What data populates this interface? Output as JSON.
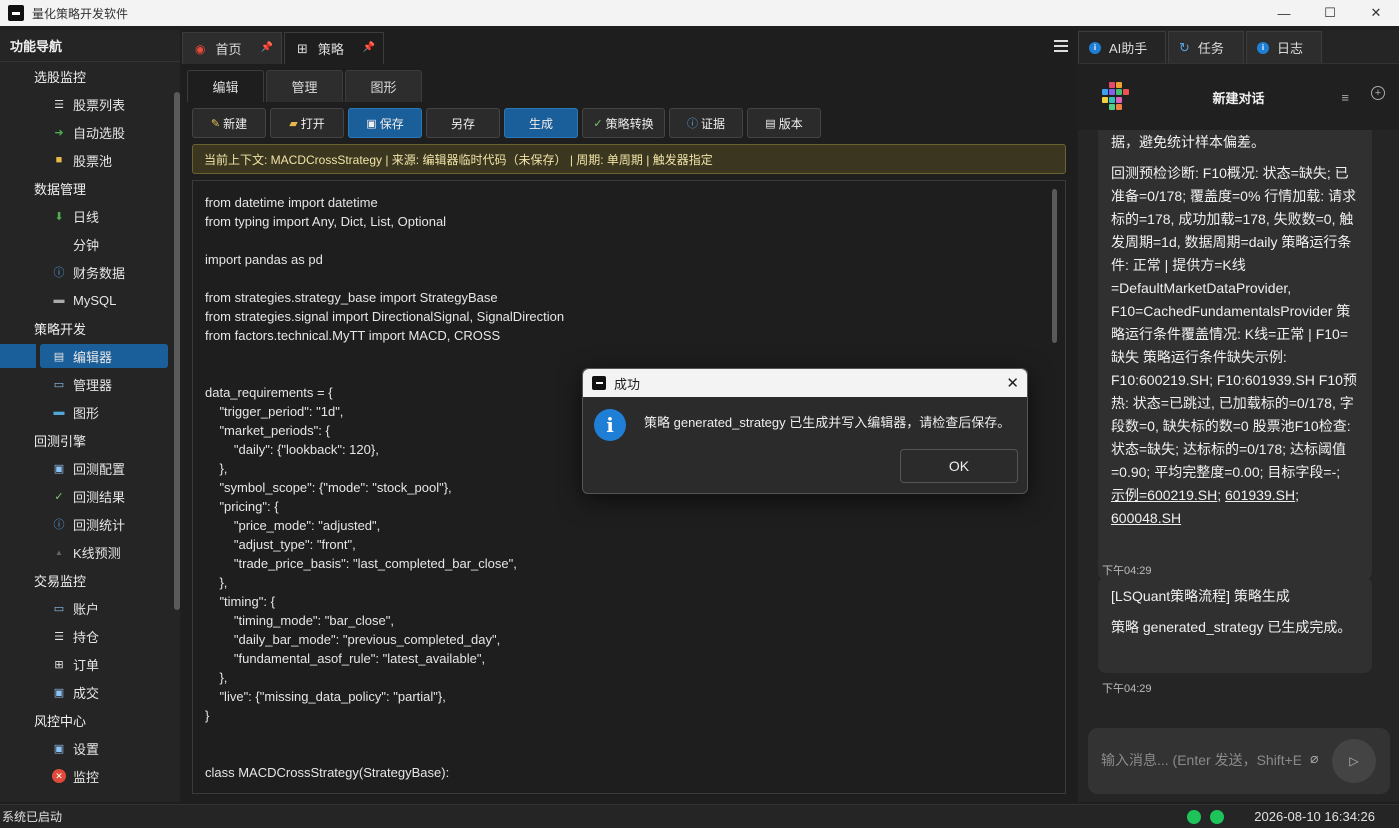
{
  "window": {
    "title": "量化策略开发软件",
    "minimize": "—",
    "maximize": "☐",
    "close": "✕"
  },
  "sidebar": {
    "header": "功能导航",
    "groups": [
      {
        "label": "选股监控",
        "items": [
          {
            "label": "股票列表",
            "icon": "list-icon"
          },
          {
            "label": "自动选股",
            "icon": "arrow-right-icon"
          },
          {
            "label": "股票池",
            "icon": "folder-icon"
          }
        ]
      },
      {
        "label": "数据管理",
        "items": [
          {
            "label": "日线",
            "icon": "download-icon"
          },
          {
            "label": "分钟",
            "icon": ""
          },
          {
            "label": "财务数据",
            "icon": "info-icon"
          },
          {
            "label": "MySQL",
            "icon": "database-icon"
          }
        ]
      },
      {
        "label": "策略开发",
        "items": [
          {
            "label": "编辑器",
            "icon": "file-icon"
          },
          {
            "label": "管理器",
            "icon": "window-icon"
          },
          {
            "label": "图形",
            "icon": "monitor-icon"
          }
        ]
      },
      {
        "label": "回测引擎",
        "items": [
          {
            "label": "回测配置",
            "icon": "config-icon"
          },
          {
            "label": "回测结果",
            "icon": "check-icon"
          },
          {
            "label": "回测统计",
            "icon": "info-icon"
          },
          {
            "label": "K线预测",
            "icon": "triangle-icon"
          }
        ]
      },
      {
        "label": "交易监控",
        "items": [
          {
            "label": "账户",
            "icon": "window-icon"
          },
          {
            "label": "持仓",
            "icon": "list-icon"
          },
          {
            "label": "订单",
            "icon": "grid-icon"
          },
          {
            "label": "成交",
            "icon": "save-icon"
          }
        ]
      },
      {
        "label": "风控中心",
        "items": [
          {
            "label": "设置",
            "icon": "config-icon"
          },
          {
            "label": "监控",
            "icon": "error-icon"
          }
        ]
      }
    ]
  },
  "doc_tabs": [
    {
      "label": "首页",
      "icon": "lifebuoy-icon"
    },
    {
      "label": "策略",
      "icon": "grid-icon"
    }
  ],
  "sub_tabs": [
    "编辑",
    "管理",
    "图形"
  ],
  "toolbar": {
    "new": "新建",
    "open": "打开",
    "save": "保存",
    "save_as": "另存",
    "generate": "生成",
    "convert": "策略转换",
    "verify": "证据",
    "version": "版本"
  },
  "context_bar": "当前上下文: MACDCrossStrategy | 来源: 编辑器临时代码（未保存） | 周期: 单周期 | 触发器指定",
  "code": "from datetime import datetime\nfrom typing import Any, Dict, List, Optional\n\nimport pandas as pd\n\nfrom strategies.strategy_base import StrategyBase\nfrom strategies.signal import DirectionalSignal, SignalDirection\nfrom factors.technical.MyTT import MACD, CROSS\n\n\ndata_requirements = {\n    \"trigger_period\": \"1d\",\n    \"market_periods\": {\n        \"daily\": {\"lookback\": 120},\n    },\n    \"symbol_scope\": {\"mode\": \"stock_pool\"},\n    \"pricing\": {\n        \"price_mode\": \"adjusted\",\n        \"adjust_type\": \"front\",\n        \"trade_price_basis\": \"last_completed_bar_close\",\n    },\n    \"timing\": {\n        \"timing_mode\": \"bar_close\",\n        \"daily_bar_mode\": \"previous_completed_day\",\n        \"fundamental_asof_rule\": \"latest_available\",\n    },\n    \"live\": {\"missing_data_policy\": \"partial\"},\n}\n\n\nclass MACDCrossStrategy(StrategyBase):",
  "right_panel": {
    "tabs": [
      "AI助手",
      "任务",
      "日志"
    ],
    "chat_title": "新建对话",
    "messages": [
      {
        "text_top": "只基于部分标的，建议先补齐缺失数据，避免统计样本偏差。",
        "text": "回测预检诊断: F10概况: 状态=缺失; 已准备=0/178; 覆盖度=0% 行情加载: 请求标的=178, 成功加载=178, 失败数=0, 触发周期=1d, 数据周期=daily 策略运行条件: 正常 | 提供方=K线=DefaultMarketDataProvider, F10=CachedFundamentalsProvider 策略运行条件覆盖情况: K线=正常 | F10=缺失 策略运行条件缺失示例: F10:600219.SH; F10:601939.SH F10预热: 状态=已跳过, 已加载标的=0/178, 字段数=0, 缺失标的数=0 股票池F10检查: 状态=缺失; 达标标的=0/178; 达标阈值=0.90; 平均完整度=0.00; 目标字段=-;",
        "link1": "示例=600219.SH",
        "link2": "601939.SH",
        "link3": "600048.SH",
        "time": "下午04:29"
      },
      {
        "title": "[LSQuant策略流程] 策略生成",
        "text": "策略 generated_strategy 已生成完成。",
        "time": "下午04:29"
      }
    ],
    "input_placeholder": "输入消息... (Enter 发送，Shift+Enter 换行)"
  },
  "statusbar": {
    "text": "系统已启动",
    "clock": "2026-08-10 16:34:26"
  },
  "dialog": {
    "title": "成功",
    "message": "策略 generated_strategy 已生成并写入编辑器，请检查后保存。",
    "ok": "OK"
  }
}
